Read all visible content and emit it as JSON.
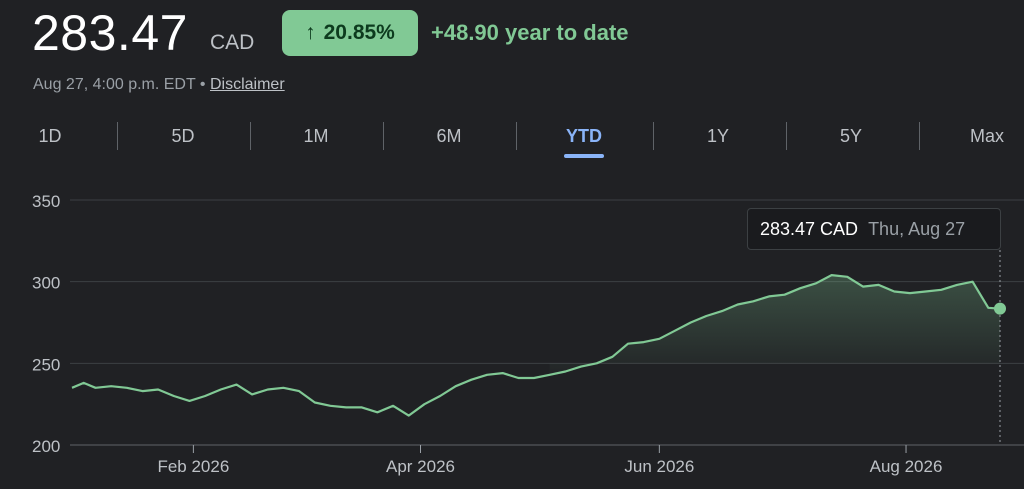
{
  "header": {
    "price": "283.47",
    "currency": "CAD",
    "change_arrow": "↑",
    "change_percent": "20.85%",
    "ytd_change": "+48.90 year to date",
    "timestamp": "Aug 27, 4:00 p.m. EDT",
    "separator": "•",
    "disclaimer": "Disclaimer"
  },
  "range_tabs": [
    {
      "label": "1D",
      "active": false
    },
    {
      "label": "5D",
      "active": false
    },
    {
      "label": "1M",
      "active": false
    },
    {
      "label": "6M",
      "active": false
    },
    {
      "label": "YTD",
      "active": true
    },
    {
      "label": "1Y",
      "active": false
    },
    {
      "label": "5Y",
      "active": false
    },
    {
      "label": "Max",
      "active": false
    }
  ],
  "tooltip": {
    "price": "283.47 CAD",
    "date": "Thu, Aug 27"
  },
  "colors": {
    "background": "#202124",
    "line": "#81c995",
    "badge_bg": "#81c995",
    "active_tab": "#8ab4f8",
    "grid": "#3c4043"
  },
  "chart_data": {
    "type": "area",
    "x_start": "2026-01-02",
    "x_end": "2026-08-27",
    "ylim": [
      200,
      350
    ],
    "yticks": [
      200,
      250,
      300,
      350
    ],
    "xticks": [
      {
        "label": "Feb 2026",
        "date": "2026-02-02"
      },
      {
        "label": "Apr 2026",
        "date": "2026-04-01"
      },
      {
        "label": "Jun 2026",
        "date": "2026-06-01"
      },
      {
        "label": "Aug 2026",
        "date": "2026-08-03"
      }
    ],
    "grid": true,
    "series": [
      {
        "dates": [
          "2026-01-02",
          "2026-01-05",
          "2026-01-08",
          "2026-01-12",
          "2026-01-16",
          "2026-01-20",
          "2026-01-24",
          "2026-01-28",
          "2026-02-01",
          "2026-02-05",
          "2026-02-09",
          "2026-02-13",
          "2026-02-17",
          "2026-02-21",
          "2026-02-25",
          "2026-03-01",
          "2026-03-05",
          "2026-03-09",
          "2026-03-13",
          "2026-03-17",
          "2026-03-21",
          "2026-03-25",
          "2026-03-29",
          "2026-04-02",
          "2026-04-06",
          "2026-04-10",
          "2026-04-14",
          "2026-04-18",
          "2026-04-22",
          "2026-04-26",
          "2026-04-30",
          "2026-05-04",
          "2026-05-08",
          "2026-05-12",
          "2026-05-16",
          "2026-05-20",
          "2026-05-24",
          "2026-05-28",
          "2026-06-01",
          "2026-06-05",
          "2026-06-09",
          "2026-06-13",
          "2026-06-17",
          "2026-06-21",
          "2026-06-25",
          "2026-06-29",
          "2026-07-03",
          "2026-07-07",
          "2026-07-11",
          "2026-07-15",
          "2026-07-19",
          "2026-07-23",
          "2026-07-27",
          "2026-07-31",
          "2026-08-04",
          "2026-08-08",
          "2026-08-12",
          "2026-08-16",
          "2026-08-20",
          "2026-08-24",
          "2026-08-27"
        ],
        "values": [
          235,
          238,
          235,
          236,
          235,
          233,
          234,
          230,
          227,
          230,
          234,
          237,
          231,
          234,
          235,
          233,
          226,
          224,
          223,
          223,
          220,
          224,
          218,
          225,
          230,
          236,
          240,
          243,
          244,
          241,
          241,
          243,
          245,
          248,
          250,
          254,
          262,
          263,
          265,
          270,
          275,
          279,
          282,
          286,
          288,
          291,
          292,
          296,
          299,
          304,
          303,
          297,
          298,
          294,
          293,
          294,
          295,
          298,
          300,
          284,
          283.47
        ]
      }
    ]
  }
}
